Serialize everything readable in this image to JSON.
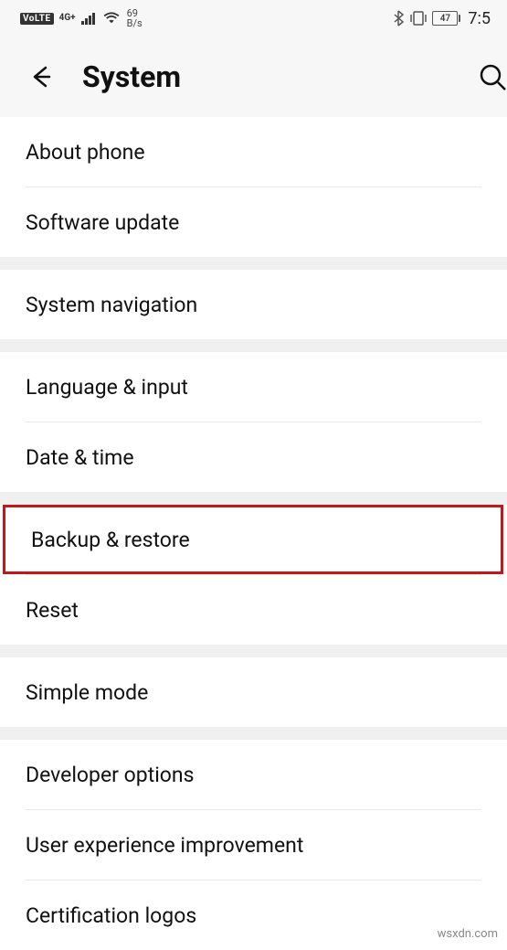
{
  "status": {
    "volte": "VoLTE",
    "net": "4G+",
    "speed_value": "69",
    "speed_unit": "B/s",
    "battery": "47",
    "time": "7:5"
  },
  "header": {
    "title": "System"
  },
  "sections": [
    {
      "items": [
        "About phone",
        "Software update"
      ]
    },
    {
      "items": [
        "System navigation"
      ]
    },
    {
      "items": [
        "Language & input",
        "Date & time"
      ]
    },
    {
      "items": [
        "Backup & restore",
        "Reset"
      ],
      "highlight_index": 0
    },
    {
      "items": [
        "Simple mode"
      ]
    },
    {
      "items": [
        "Developer options",
        "User experience improvement",
        "Certification logos"
      ]
    }
  ],
  "watermark": "wsxdn.com"
}
